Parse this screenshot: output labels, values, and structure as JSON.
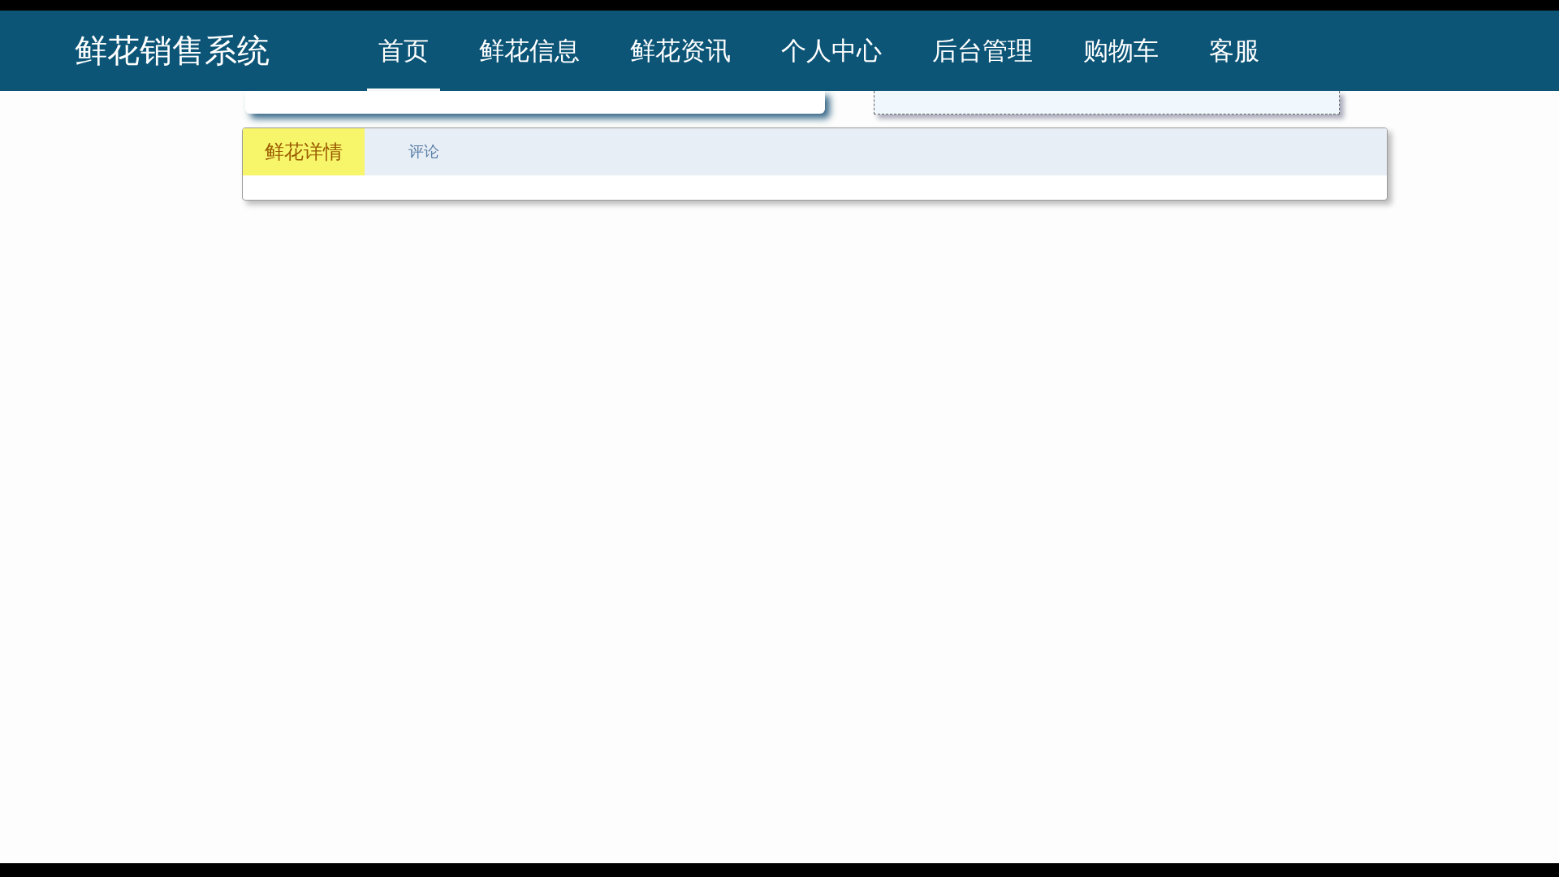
{
  "site_title": "鲜花销售系统",
  "nav": [
    {
      "label": "首页",
      "selected": true
    },
    {
      "label": "鲜花信息",
      "selected": false
    },
    {
      "label": "鲜花资讯",
      "selected": false
    },
    {
      "label": "个人中心",
      "selected": false
    },
    {
      "label": "后台管理",
      "selected": false
    },
    {
      "label": "购物车",
      "selected": false
    },
    {
      "label": "客服",
      "selected": false
    }
  ],
  "detail_tabs": [
    {
      "label": "鲜花详情",
      "selected": true
    },
    {
      "label": "评论",
      "selected": false
    }
  ]
}
